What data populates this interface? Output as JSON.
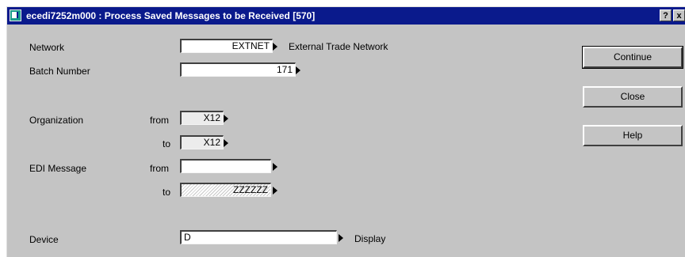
{
  "window": {
    "title": "ecedi7252m000 : Process Saved Messages to be Received [570]",
    "help_btn": "?",
    "close_btn": "x"
  },
  "form": {
    "network": {
      "label": "Network",
      "value": "EXTNET",
      "description": "External Trade Network"
    },
    "batch": {
      "label": "Batch Number",
      "value": "171"
    },
    "organization": {
      "label": "Organization",
      "from_label": "from",
      "to_label": "to",
      "from_value": "X12",
      "to_value": "X12"
    },
    "edi_message": {
      "label": "EDI Message",
      "from_label": "from",
      "to_label": "to",
      "from_value": "",
      "to_value": "ZZZZZZ"
    },
    "device": {
      "label": "Device",
      "value": "D",
      "description": "Display"
    }
  },
  "buttons": {
    "continue": "Continue",
    "close": "Close",
    "help": "Help"
  }
}
